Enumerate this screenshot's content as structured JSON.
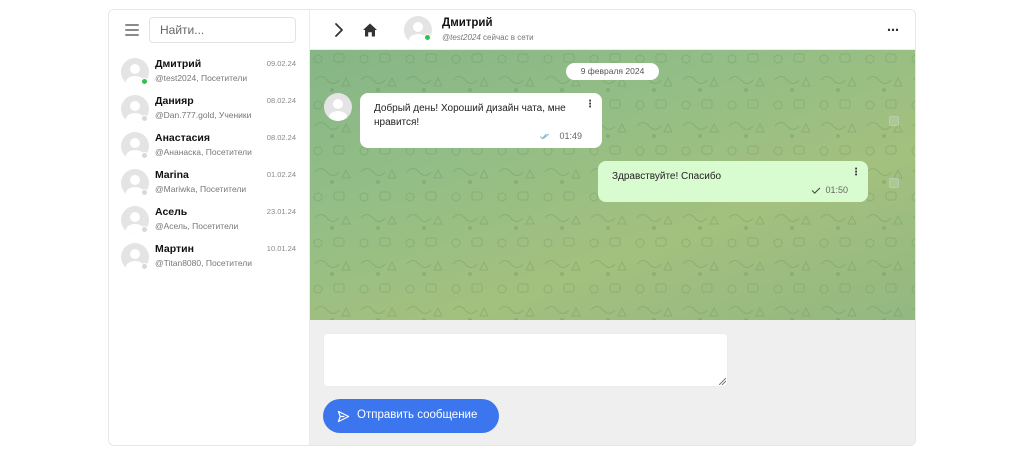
{
  "sidebar": {
    "search_placeholder": "Найти...",
    "contacts": [
      {
        "name": "Дмитрий",
        "handle": "@test2024, Посетители",
        "date": "09.02.24",
        "online": true
      },
      {
        "name": "Данияр",
        "handle": "@Dan.777.gold, Ученики",
        "date": "08.02.24",
        "online": false
      },
      {
        "name": "Анастасия",
        "handle": "@Ананаска, Посетители",
        "date": "08.02.24",
        "online": false
      },
      {
        "name": "Marina",
        "handle": "@Mariwka, Посетители",
        "date": "01.02.24",
        "online": false
      },
      {
        "name": "Асель",
        "handle": "@Асель, Посетители",
        "date": "23.01.24",
        "online": false
      },
      {
        "name": "Мартин",
        "handle": "@Titan8080, Посетители",
        "date": "10.01.24",
        "online": false
      }
    ]
  },
  "header": {
    "name": "Дмитрий",
    "handle": "@test2024",
    "status": "сейчас в сети",
    "more_label": "⋯"
  },
  "chat": {
    "date_divider": "9 февраля 2024",
    "messages": [
      {
        "direction": "in",
        "text": "Добрый день! Хороший дизайн чата, мне нравится!",
        "time": "01:49",
        "read": true
      },
      {
        "direction": "out",
        "text": "Здравствуйте! Спасибо",
        "time": "01:50",
        "read": false
      }
    ],
    "menu_glyph": "⋮"
  },
  "composer": {
    "input_value": "",
    "send_label": "Отправить сообщение"
  },
  "colors": {
    "accent": "#3b76ee",
    "online": "#2ec24a",
    "outgoing_bubble": "#d9fbd0",
    "chat_bg": "#94be86"
  },
  "icons": [
    "menu-icon",
    "chevron-right-icon",
    "home-icon",
    "more-icon",
    "read-check-icon",
    "sent-check-icon",
    "send-icon"
  ]
}
